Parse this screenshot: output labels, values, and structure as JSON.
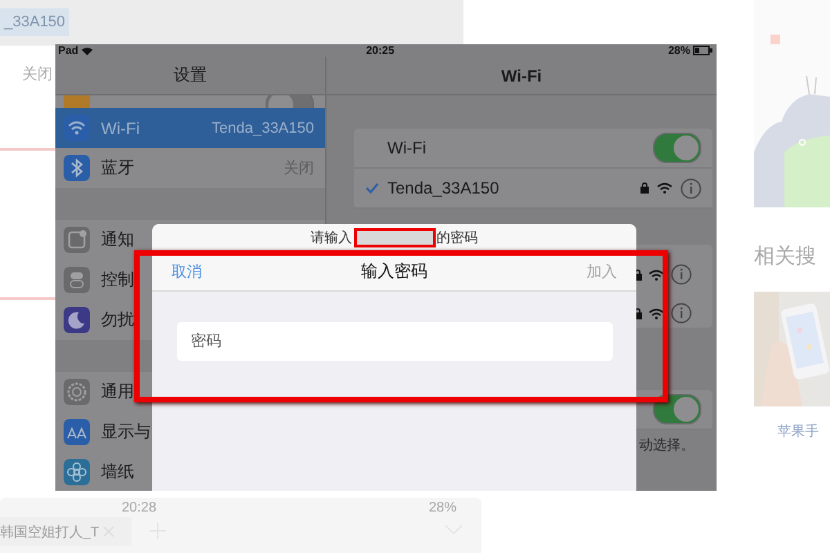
{
  "background_page": {
    "selected_text": "_33A150",
    "value_text": "关闭",
    "related_heading": "相关搜",
    "related_caption": "苹果手",
    "browser_bar": {
      "time": "20:28",
      "battery": "28%",
      "tab_title": "韩国空姐打人_T"
    }
  },
  "ipad": {
    "status_bar": {
      "carrier": "Pad",
      "time": "20:25",
      "battery": "28%"
    },
    "sidebar": {
      "title": "设置",
      "groups": [
        [
          {
            "kind": "orange",
            "toggle": false
          },
          {
            "kind": "wifi",
            "label": "Wi-Fi",
            "value": "Tenda_33A150",
            "selected": true
          },
          {
            "kind": "bluetooth",
            "label": "蓝牙",
            "value": "关闭",
            "selected": false
          }
        ],
        [
          {
            "kind": "notify",
            "label": "通知",
            "selected": false
          },
          {
            "kind": "control",
            "label": "控制",
            "selected": false
          },
          {
            "kind": "moon",
            "label": "勿扰",
            "selected": false
          }
        ],
        [
          {
            "kind": "gear",
            "label": "通用",
            "selected": false
          },
          {
            "kind": "display",
            "label": "显示与",
            "selected": false
          },
          {
            "kind": "wallpaper",
            "label": "墙纸",
            "selected": false
          }
        ]
      ]
    },
    "detail": {
      "title": "Wi-Fi",
      "wifi_label": "Wi-Fi",
      "wifi_on": true,
      "networks": [
        {
          "name": "Tenda_33A150",
          "connected": true
        }
      ],
      "ask_to_join": {
        "on": true,
        "note": "动选择。"
      }
    },
    "dialog": {
      "prompt_before": "请输入",
      "prompt_after": "的密码",
      "cancel": "取消",
      "title": "输入密码",
      "join": {
        "label": "加入",
        "disabled": true
      },
      "password_placeholder": "密码"
    }
  }
}
